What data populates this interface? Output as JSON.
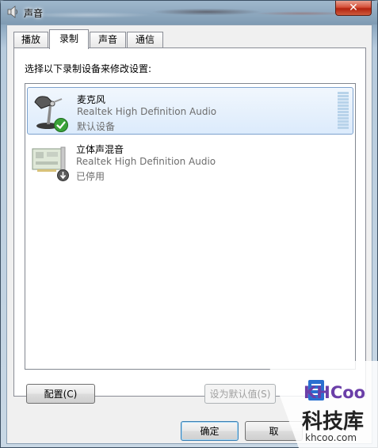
{
  "window": {
    "title": "声音",
    "close_glyph": "✕"
  },
  "tabs": [
    {
      "label": "播放",
      "active": false
    },
    {
      "label": "录制",
      "active": true
    },
    {
      "label": "声音",
      "active": false
    },
    {
      "label": "通信",
      "active": false
    }
  ],
  "panel": {
    "instruction": "选择以下录制设备来修改设置:"
  },
  "devices": [
    {
      "name": "麦克风",
      "driver": "Realtek High Definition Audio",
      "status": "默认设备",
      "icon": "microphone-icon",
      "badge": "green-check-icon",
      "selected": true
    },
    {
      "name": "立体声混音",
      "driver": "Realtek High Definition Audio",
      "status": "已停用",
      "icon": "sound-card-icon",
      "badge": "disabled-arrow-icon",
      "selected": false
    }
  ],
  "buttons": {
    "configure": "配置(C)",
    "set_default": "设为默认值(S)",
    "ok": "确定",
    "cancel": "取"
  },
  "watermark": {
    "logo": "KHCoo",
    "name": "科技库",
    "site": "khcoo.com"
  },
  "colors": {
    "selection_border": "#7da2ce",
    "check_green": "#3aa33a",
    "close_red": "#c8391f"
  }
}
